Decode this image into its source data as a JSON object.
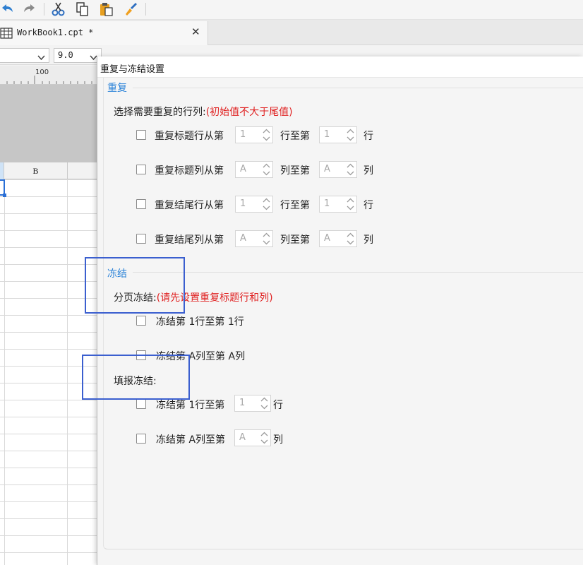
{
  "toolbar": {
    "icons": [
      "undo-icon",
      "redo-icon",
      "cut-icon",
      "copy-icon",
      "paste-icon",
      "format-painter-icon"
    ]
  },
  "tab": {
    "title": "WorkBook1.cpt *",
    "close": "✕"
  },
  "formatbar": {
    "font_size": "9.0"
  },
  "sheet": {
    "ruler_label": "100",
    "column_b": "B"
  },
  "dialog": {
    "title": "重复与冻结设置",
    "repeat": {
      "section_title": "重复",
      "select_label": "选择需要重复的行列:",
      "select_hint": "(初始值不大于尾值)",
      "rows": [
        {
          "label": "重复标题行从第",
          "from": "1",
          "mid": "行至第",
          "to": "1",
          "unit": "行"
        },
        {
          "label": "重复标题列从第",
          "from": "A",
          "mid": "列至第",
          "to": "A",
          "unit": "列"
        },
        {
          "label": "重复结尾行从第",
          "from": "1",
          "mid": "行至第",
          "to": "1",
          "unit": "行"
        },
        {
          "label": "重复结尾列从第",
          "from": "A",
          "mid": "列至第",
          "to": "A",
          "unit": "列"
        }
      ]
    },
    "freeze": {
      "section_title": "冻结",
      "page_label": "分页冻结:",
      "page_hint": "(请先设置重复标题行和列)",
      "page_rows": [
        {
          "prefix": "冻结第",
          "from": "1",
          "mid": "行至第",
          "to": "1",
          "unit": "行"
        },
        {
          "prefix": "冻结第",
          "from": "A",
          "mid": "列至第",
          "to": "A",
          "unit": "列"
        }
      ],
      "fill_label": "填报冻结:",
      "fill_rows": [
        {
          "prefix": "冻结第",
          "from": "1",
          "mid": "行至第",
          "to": "1",
          "unit": "行"
        },
        {
          "prefix": "冻结第",
          "from": "A",
          "mid": "列至第",
          "to": "A",
          "unit": "列"
        }
      ]
    }
  },
  "colors": {
    "accent": "#2a82d8",
    "hint": "#e02020",
    "annotation": "#3b5fcf"
  }
}
